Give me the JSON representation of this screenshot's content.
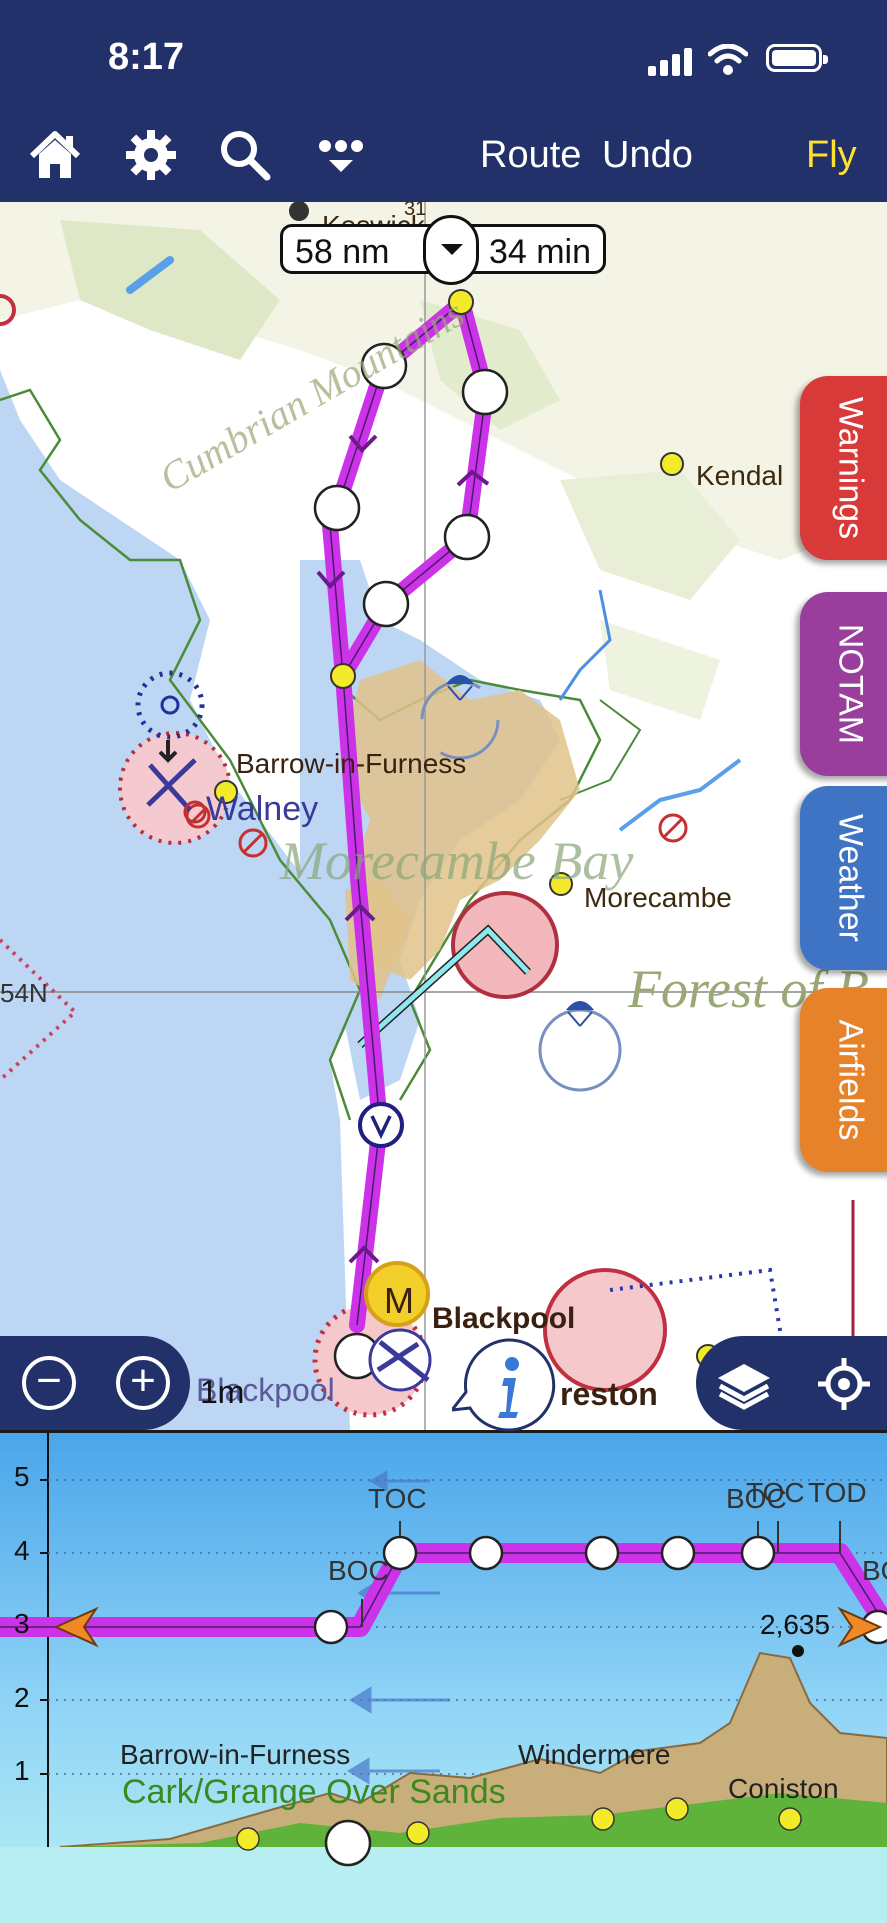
{
  "status": {
    "time": "8:17"
  },
  "toolbar": {
    "route_label": "Route",
    "undo_label": "Undo",
    "fly_label": "Fly",
    "fly_color": "#ffe030",
    "icons": [
      "home-icon",
      "gear-icon",
      "search-icon",
      "more-icon"
    ]
  },
  "route_summary": {
    "distance": "58 nm",
    "time": "34 min"
  },
  "side_tabs": [
    {
      "label": "Warnings",
      "color": "#d83a3a"
    },
    {
      "label": "NOTAM",
      "color": "#9a3e9e"
    },
    {
      "label": "Weather",
      "color": "#3f74c4"
    },
    {
      "label": "Airfields",
      "color": "#e6832a"
    }
  ],
  "map": {
    "places": {
      "keswick": "Keswick",
      "kendal": "Kendal",
      "barrow": "Barrow-in-Furness",
      "walney": "Walney",
      "morecambe": "Morecambe",
      "blackpool": "Blackpool",
      "blackpool_partial": "Blackpool",
      "preston_partial": "reston",
      "morecambe_bay": "Morecambe Bay",
      "forest": "Forest of B",
      "cumbrian": "Cumbrian Mountains",
      "latitude": "54N",
      "small_number": "31"
    },
    "motorway_badge": "M",
    "scale_label": "1m",
    "route_color": "#cc33e8"
  },
  "profile": {
    "y_ticks": [
      "5",
      "4",
      "3",
      "2",
      "1"
    ],
    "markers": {
      "toc1": "TOC",
      "boc1": "BOC",
      "boc2": "BOC",
      "toc2": "TOC",
      "tod": "TOD",
      "bo_partial": "BO"
    },
    "peak_label": "2,635",
    "places": {
      "barrow": "Barrow-in-Furness",
      "windermere": "Windermere",
      "coniston": "Coniston",
      "cark": "Cark/Grange Over Sands"
    }
  }
}
